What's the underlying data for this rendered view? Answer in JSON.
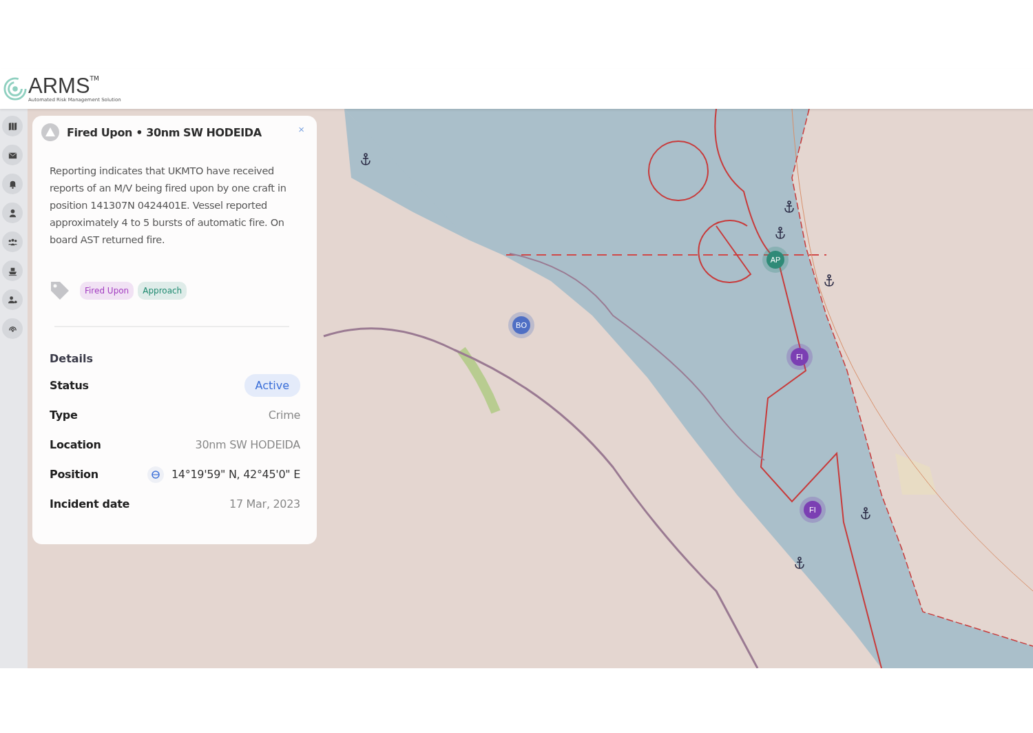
{
  "header": {
    "logo_text": "ARMS",
    "logo_trademark": "TM",
    "logo_tagline": "Automated Risk Management Solution"
  },
  "sidebar": {
    "items": [
      {
        "kind": "map",
        "selected": false
      },
      {
        "kind": "mail",
        "selected": false
      },
      {
        "kind": "bell",
        "selected": false
      },
      {
        "kind": "person",
        "selected": false
      },
      {
        "kind": "group",
        "selected": false
      },
      {
        "kind": "ship",
        "selected": false
      },
      {
        "kind": "person-gear",
        "selected": false
      },
      {
        "kind": "radar",
        "selected": false
      }
    ]
  },
  "map": {
    "markers": [
      {
        "label": "BO",
        "color": "#4f6fc4"
      },
      {
        "label": "AP",
        "color": "#2f8a77"
      },
      {
        "label": "FI",
        "color": "#7b3fb3"
      },
      {
        "label": "FI",
        "color": "#7b3fb3"
      }
    ]
  },
  "incident_panel": {
    "title": "Fired Upon • 30nm SW HODEIDA",
    "close": "×",
    "description": "Reporting indicates that UKMTO have received reports of an M/V being fired upon by one craft in position 141307N 0424401E. Vessel reported approximately 4 to 5 bursts of automatic fire. On board AST returned fire.",
    "tags": [
      {
        "label": "Fired Upon",
        "color": "#a23cc0"
      },
      {
        "label": "Approach",
        "color": "#1f8a70"
      }
    ],
    "details_heading": "Details",
    "details": [
      {
        "kind": "badge",
        "label": "Status",
        "value": "Active"
      },
      {
        "kind": "text",
        "label": "Type",
        "value": "Crime"
      },
      {
        "kind": "text",
        "label": "Location",
        "value": "30nm SW HODEIDA"
      },
      {
        "kind": "position",
        "label": "Position",
        "value": "14°19'59\" N, 42°45'0\" E"
      },
      {
        "kind": "text",
        "label": "Incident date",
        "value": "17 Mar, 2023"
      }
    ]
  }
}
